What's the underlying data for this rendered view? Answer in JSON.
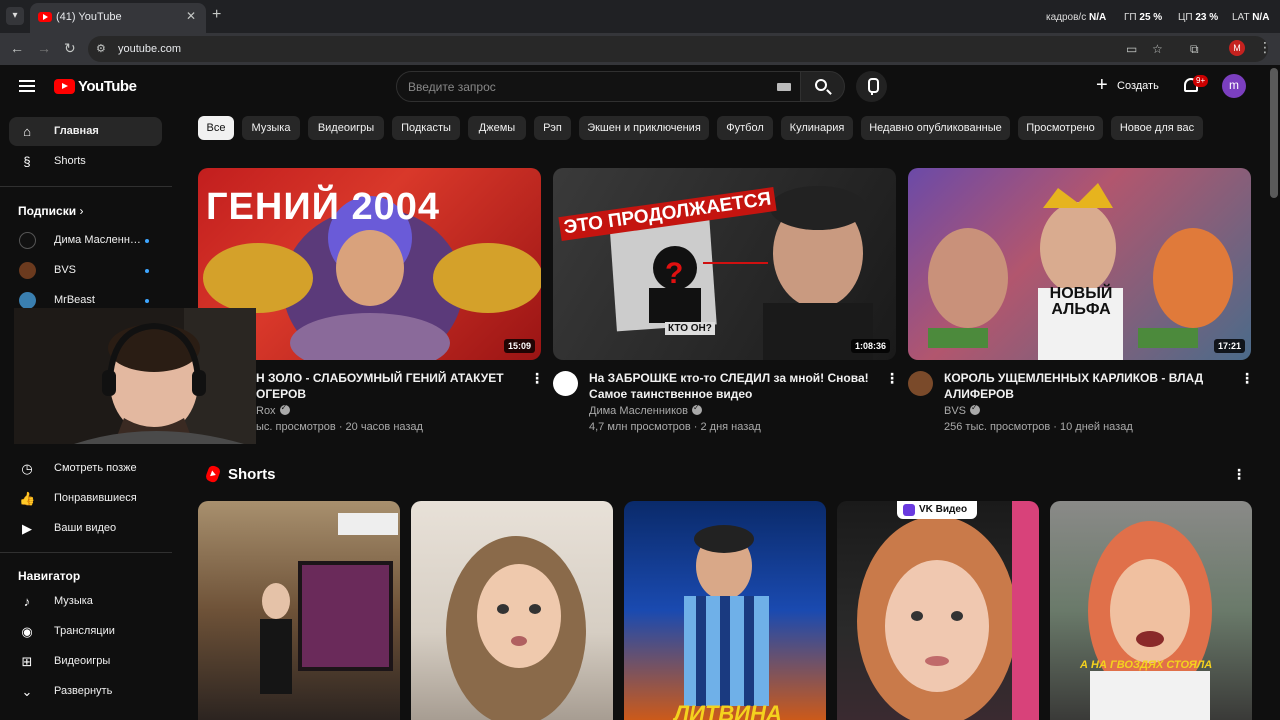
{
  "browser": {
    "tab_title": "(41) YouTube",
    "url": "youtube.com",
    "perf": [
      {
        "label": "кадров/с",
        "value": "N/A"
      },
      {
        "label": "ГП",
        "value": "25 %"
      },
      {
        "label": "ЦП",
        "value": "23 %"
      },
      {
        "label": "LAT",
        "value": "N/A"
      }
    ],
    "profile_letter": "M"
  },
  "header": {
    "logo": "YouTube",
    "search_placeholder": "Введите запрос",
    "create_label": "Создать",
    "notif_badge": "9+",
    "avatar_letter": "m"
  },
  "sidebar": {
    "top": [
      {
        "label": "Главная",
        "icon": "home-icon"
      },
      {
        "label": "Shorts",
        "icon": "shorts-icon"
      }
    ],
    "subs_heading": "Подписки",
    "subs": [
      {
        "label": "Дима Масленн…"
      },
      {
        "label": "BVS"
      },
      {
        "label": "MrBeast"
      }
    ],
    "you": [
      {
        "label": "Смотреть позже",
        "icon": "clock-icon"
      },
      {
        "label": "Понравившиеся",
        "icon": "thumbs-up-icon"
      },
      {
        "label": "Ваши видео",
        "icon": "play-square-icon"
      }
    ],
    "nav_heading": "Навигатор",
    "nav": [
      {
        "label": "Музыка",
        "icon": "music-note-icon"
      },
      {
        "label": "Трансляции",
        "icon": "live-icon"
      },
      {
        "label": "Видеоигры",
        "icon": "gamepad-icon"
      },
      {
        "label": "Развернуть",
        "icon": "chevron-down-icon"
      }
    ]
  },
  "chips": [
    "Все",
    "Музыка",
    "Видеоигры",
    "Подкасты",
    "Джемы",
    "Рэп",
    "Экшен и приключения",
    "Футбол",
    "Кулинария",
    "Недавно опубликованные",
    "Просмотрено",
    "Новое для вас"
  ],
  "videos": [
    {
      "title": "Н ЗОЛО - СЛАБОУМНЫЙ ГЕНИЙ АТАКУЕТ ОГЕРОВ",
      "channel": "Rox",
      "meta": "ыс. просмотров · 20 часов назад",
      "duration": "15:09",
      "thumb_text": "ГЕНИЙ 2004"
    },
    {
      "title": "На ЗАБРОШКЕ кто-то СЛЕДИЛ за мной! Снова! Самое таинственное видео",
      "channel": "Дима Масленников",
      "meta": "4,7 млн просмотров · 2 дня назад",
      "duration": "1:08:36",
      "thumb_text": "ЭТО ПРОДОЛЖАЕТСЯ",
      "thumb_sub": "КТО ОН?"
    },
    {
      "title": "КОРОЛЬ УЩЕМЛЕННЫХ КАРЛИКОВ - ВЛАД АЛИФЕРОВ",
      "channel": "BVS",
      "meta": "256 тыс. просмотров · 10 дней назад",
      "duration": "17:21",
      "thumb_text": "НОВЫЙ АЛЬФА"
    }
  ],
  "shorts": {
    "heading": "Shorts",
    "items": [
      {
        "overlay": ""
      },
      {
        "overlay": ""
      },
      {
        "overlay": "ЛИТВИНА"
      },
      {
        "overlay": "VK Видео"
      },
      {
        "overlay": "А НА ГВОЗДЯХ СТОЯЛА"
      }
    ]
  }
}
